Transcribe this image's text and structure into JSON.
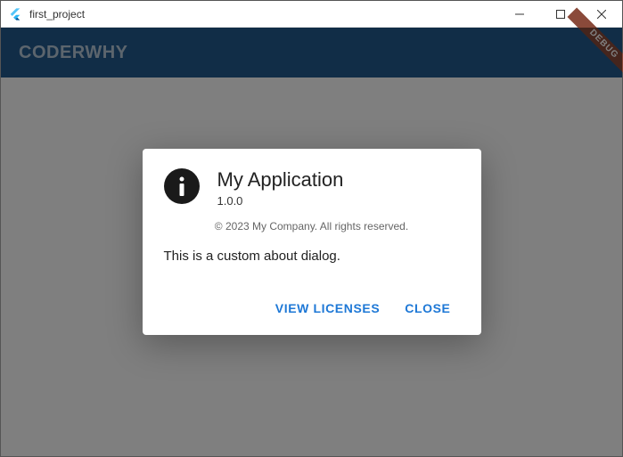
{
  "window": {
    "title": "first_project"
  },
  "appbar": {
    "title": "CODERWHY"
  },
  "debug_banner": "DEBUG",
  "dialog": {
    "app_name": "My Application",
    "version": "1.0.0",
    "legalese": "© 2023 My Company. All rights reserved.",
    "body": "This is a custom about dialog.",
    "actions": {
      "view_licenses": "VIEW LICENSES",
      "close": "CLOSE"
    }
  }
}
